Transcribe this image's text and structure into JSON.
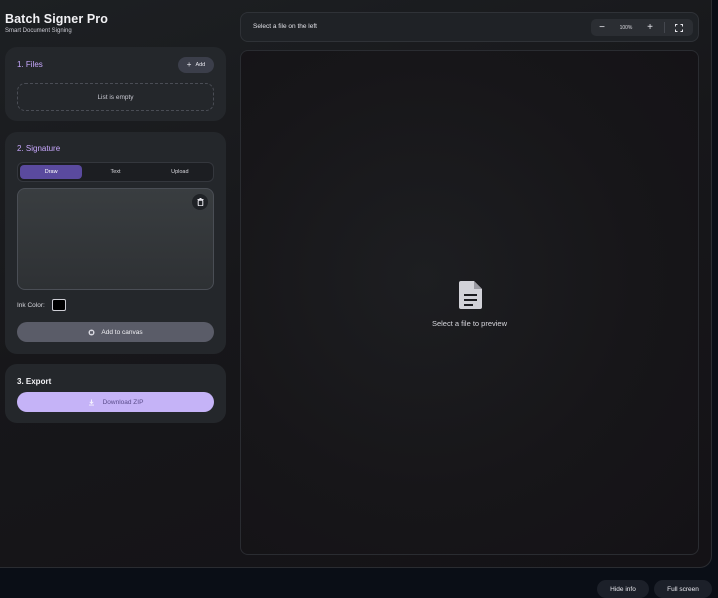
{
  "app": {
    "title": "Batch Signer Pro",
    "subtitle": "Smart Document Signing"
  },
  "files": {
    "title": "1. Files",
    "add_label": "Add",
    "empty_text": "List is empty"
  },
  "signature": {
    "title": "2. Signature",
    "tabs": [
      {
        "label": "Draw",
        "active": true
      },
      {
        "label": "Text",
        "active": false
      },
      {
        "label": "Upload",
        "active": false
      }
    ],
    "ink_label": "Ink Color:",
    "ink_color": "#000000",
    "add_canvas_label": "Add to canvas"
  },
  "export": {
    "title": "3. Export",
    "download_label": "Download ZIP"
  },
  "toolbar": {
    "title": "Select a file on the left",
    "zoom_value": "100%"
  },
  "preview": {
    "empty_text": "Select a file to preview"
  },
  "footer": {
    "hide_info_label": "Hide info",
    "fullscreen_label": "Full screen"
  },
  "colors": {
    "accent": "#c8a8ff",
    "active_tab": "#5a4a9e",
    "download_button": "#c5b3f7"
  }
}
